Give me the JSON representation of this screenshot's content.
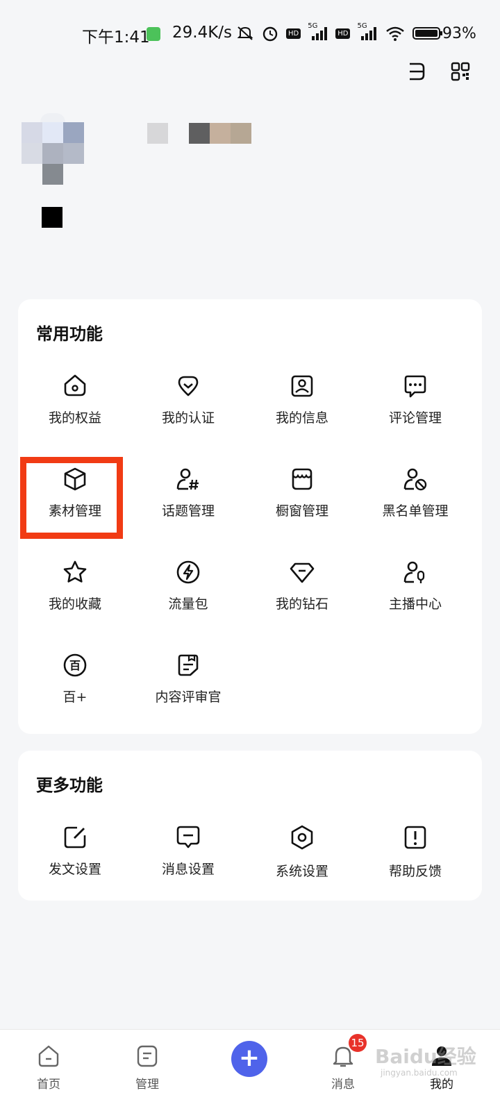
{
  "status_bar": {
    "time": "下午1:41",
    "speed": "29.4K/s",
    "battery": "93%",
    "network_labels": [
      "HD",
      "5G",
      "HD",
      "5G"
    ]
  },
  "common_functions": {
    "title": "常用功能",
    "items": [
      {
        "label": "我的权益",
        "icon": "crown-icon"
      },
      {
        "label": "我的认证",
        "icon": "badge-check-icon"
      },
      {
        "label": "我的信息",
        "icon": "profile-card-icon"
      },
      {
        "label": "评论管理",
        "icon": "comment-icon"
      },
      {
        "label": "素材管理",
        "icon": "cube-icon"
      },
      {
        "label": "话题管理",
        "icon": "user-hashtag-icon"
      },
      {
        "label": "橱窗管理",
        "icon": "store-icon"
      },
      {
        "label": "黑名单管理",
        "icon": "user-block-icon"
      },
      {
        "label": "我的收藏",
        "icon": "star-icon"
      },
      {
        "label": "流量包",
        "icon": "lightning-icon"
      },
      {
        "label": "我的钻石",
        "icon": "diamond-icon"
      },
      {
        "label": "主播中心",
        "icon": "user-mic-icon"
      },
      {
        "label": "百+",
        "icon": "bai-plus-icon",
        "icon_text": "百"
      },
      {
        "label": "内容评审官",
        "icon": "review-doc-icon"
      }
    ]
  },
  "more_functions": {
    "title": "更多功能",
    "items": [
      {
        "label": "发文设置",
        "icon": "edit-icon"
      },
      {
        "label": "消息设置",
        "icon": "message-icon"
      },
      {
        "label": "系统设置",
        "icon": "hexagon-settings-icon"
      },
      {
        "label": "帮助反馈",
        "icon": "exclamation-icon"
      }
    ]
  },
  "bottom_nav": {
    "items": [
      {
        "label": "首页",
        "icon": "home-icon"
      },
      {
        "label": "管理",
        "icon": "manage-icon"
      },
      {
        "label": "",
        "icon": "plus-icon"
      },
      {
        "label": "消息",
        "icon": "bell-icon"
      },
      {
        "label": "我的",
        "icon": "profile-icon"
      }
    ],
    "message_badge": "15",
    "plus_symbol": "+"
  },
  "watermark": {
    "text": "Baidu经验",
    "sub": "jingyan.baidu.com"
  },
  "colors": {
    "accent": "#4f63ea",
    "highlight": "#f13b14",
    "badge": "#e8322a",
    "card_bg": "#ffffff",
    "page_bg": "#f5f6f8"
  }
}
